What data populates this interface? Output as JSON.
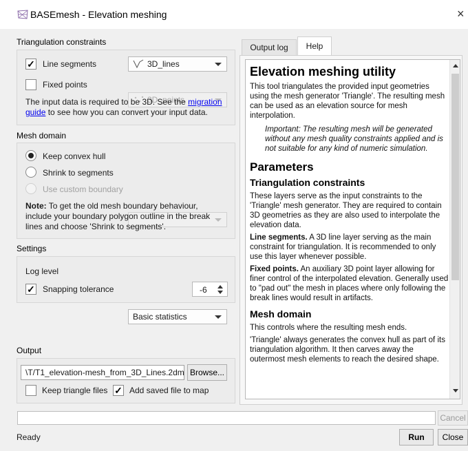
{
  "window": {
    "title": "BASEmesh - Elevation meshing",
    "close_glyph": "×"
  },
  "triangulation": {
    "title": "Triangulation constraints",
    "line_segments": {
      "label": "Line segments",
      "checked": true,
      "layer": "3D_lines"
    },
    "fixed_points": {
      "label": "Fixed points",
      "checked": false,
      "layer": "3D_points"
    },
    "info_prefix": "The input data is required to be 3D. See the ",
    "info_link_1": "migration",
    "info_link_2": "guide",
    "info_suffix": " to see how you can convert your input data."
  },
  "mesh_domain": {
    "title": "Mesh domain",
    "options": [
      {
        "label": "Keep convex hull",
        "selected": true,
        "enabled": true
      },
      {
        "label": "Shrink to segments",
        "selected": false,
        "enabled": true
      },
      {
        "label": "Use custom boundary",
        "selected": false,
        "enabled": false
      }
    ],
    "custom_boundary_value": "",
    "note_bold": "Note:",
    "note_line1": " To get the old mesh boundary behaviour,",
    "note_line2": "include your boundary polygon outline in the break",
    "note_line3": "lines and choose 'Shrink to segments'."
  },
  "settings": {
    "title": "Settings",
    "log_level_label": "Log level",
    "log_level_value": "Basic statistics",
    "snapping_label": "Snapping tolerance",
    "snapping_checked": true,
    "snapping_value": "-6"
  },
  "output": {
    "title": "Output",
    "path": "\\T/T1_elevation-mesh_from_3D_Lines.2dm",
    "browse_label": "Browse...",
    "keep_triangle_label": "Keep triangle files",
    "keep_triangle_checked": false,
    "add_to_map_label": "Add saved file to map",
    "add_to_map_checked": true
  },
  "tabs": [
    {
      "label": "Output log",
      "active": false
    },
    {
      "label": "Help",
      "active": true
    }
  ],
  "help": {
    "heading": "Elevation meshing utility",
    "intro": "This tool triangulates the provided input geometries using the mesh generator 'Triangle'. The resulting mesh can be used as an elevation source for mesh interpolation.",
    "important": "Important: The resulting mesh will be generated without any mesh quality constraints applied and is not suitable for any kind of numeric simulation.",
    "parameters_heading": "Parameters",
    "tc_heading": "Triangulation constraints",
    "tc_text": "These layers serve as the input constraints to the 'Triangle' mesh generator. They are required to contain 3D geometries as they are also used to interpolate the elevation data.",
    "ls_bold": "Line segments.",
    "ls_text": " A 3D line layer serving as the main constraint for triangulation. It is recommended to only use this layer whenever possible.",
    "fp_bold": "Fixed points.",
    "fp_text": " An auxiliary 3D point layer allowing for finer control of the interpolated elevation. Generally used to \"pad out\" the mesh in places where only following the break lines would result in artifacts.",
    "md_heading": "Mesh domain",
    "md_text1": "This controls where the resulting mesh ends.",
    "md_text2": "'Triangle' always generates the convex hull as part of its triangulation algorithm. It then carves away the outermost mesh elements to reach the desired shape."
  },
  "footer": {
    "progress_fraction": 0,
    "cancel_label": "Cancel",
    "status": "Ready",
    "run_label": "Run",
    "close_label": "Close"
  }
}
